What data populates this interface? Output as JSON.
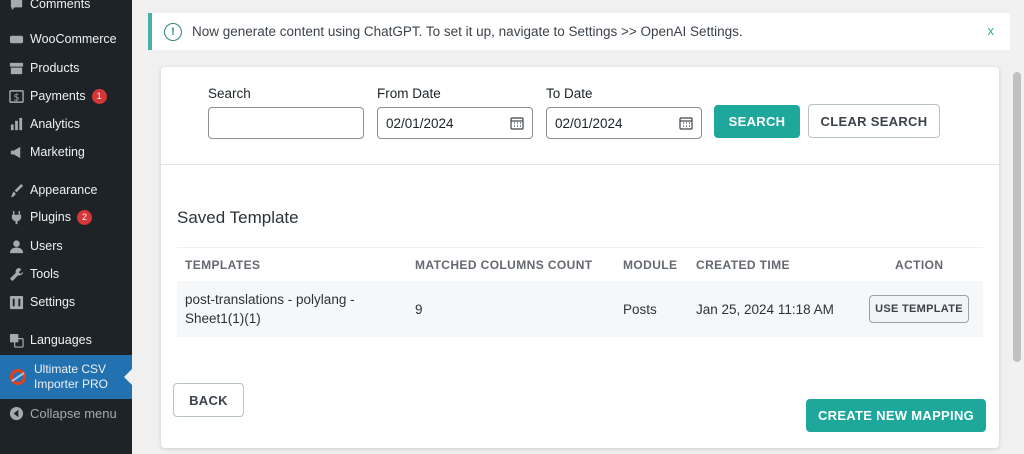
{
  "sidebar": {
    "items": [
      {
        "label": "Comments",
        "icon": "comment-icon"
      },
      {
        "label": "WooCommerce",
        "icon": "woo-icon"
      },
      {
        "label": "Products",
        "icon": "archive-icon"
      },
      {
        "label": "Payments",
        "icon": "dollar-icon",
        "badge": "1"
      },
      {
        "label": "Analytics",
        "icon": "bar-chart-icon"
      },
      {
        "label": "Marketing",
        "icon": "megaphone-icon"
      },
      {
        "label": "Appearance",
        "icon": "paintbrush-icon"
      },
      {
        "label": "Plugins",
        "icon": "plug-icon",
        "badge": "2"
      },
      {
        "label": "Users",
        "icon": "user-icon"
      },
      {
        "label": "Tools",
        "icon": "wrench-icon"
      },
      {
        "label": "Settings",
        "icon": "settings-icon"
      },
      {
        "label": "Languages",
        "icon": "translate-icon"
      },
      {
        "label": "Ultimate CSV Importer PRO",
        "icon": "plugin-logo-icon"
      }
    ],
    "collapse_label": "Collapse menu"
  },
  "notice": {
    "text": "Now generate content using ChatGPT. To set it up, navigate to Settings >> OpenAI Settings.",
    "dismiss": "x"
  },
  "filters": {
    "search_label": "Search",
    "search_value": "",
    "from_label": "From Date",
    "from_value": "02/01/2024",
    "to_label": "To Date",
    "to_value": "02/01/2024",
    "search_button": "SEARCH",
    "clear_button": "CLEAR SEARCH"
  },
  "templates": {
    "title": "Saved Template",
    "columns": [
      "TEMPLATES",
      "MATCHED COLUMNS COUNT",
      "MODULE",
      "CREATED TIME",
      "ACTION"
    ],
    "rows": [
      {
        "name_line1": "post-translations - polylang -",
        "name_line2": "Sheet1(1)(1)",
        "matched": "9",
        "module": "Posts",
        "created": "Jan 25, 2024 11:18 AM",
        "action": "USE TEMPLATE"
      }
    ]
  },
  "footer": {
    "back_button": "BACK",
    "create_button": "CREATE NEW MAPPING"
  },
  "colors": {
    "sidebar_bg": "#1d2327",
    "active_bg": "#2271b1",
    "primary": "#1da89b",
    "badge": "#d63638"
  }
}
